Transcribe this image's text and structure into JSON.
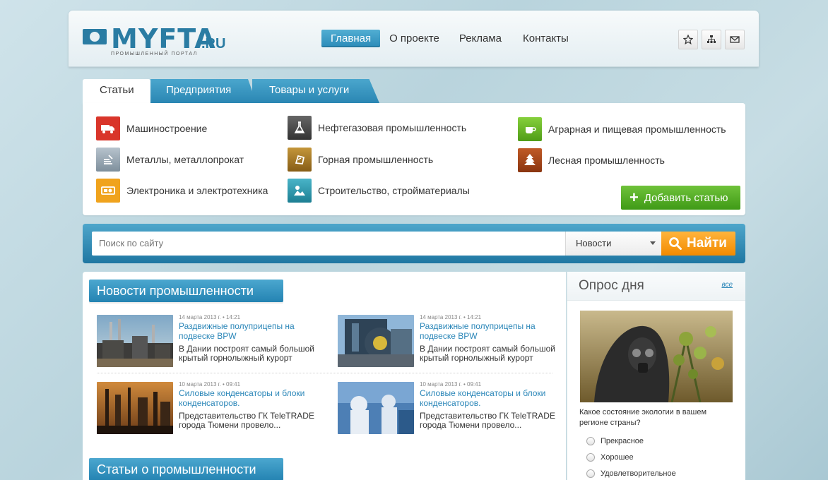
{
  "logo": {
    "name": "MYFTA",
    "tld": ".RU",
    "subtitle": "ПРОМЫШЛЕННЫЙ ПОРТАЛ"
  },
  "nav": {
    "items": [
      "Главная",
      "О проекте",
      "Реклама",
      "Контакты"
    ],
    "active": "Главная"
  },
  "header_icons": [
    "star-icon",
    "sitemap-icon",
    "mail-icon"
  ],
  "tabs": [
    "Статьи",
    "Предприятия",
    "Товары и услуги"
  ],
  "categories": [
    {
      "label": "Машиностроение",
      "icon": "truck-icon",
      "color": "#d9352a"
    },
    {
      "label": "Металлы, металлопрокат",
      "icon": "metal-icon",
      "color": "#8fa0ae"
    },
    {
      "label": "Электроника и электротехника",
      "icon": "electronics-icon",
      "color": "#f0a31d"
    },
    {
      "label": "Нефтегазовая промышленность",
      "icon": "flask-icon",
      "color": "#4a4a4a"
    },
    {
      "label": "Горная промышленность",
      "icon": "ore-icon",
      "color": "#a57a2a"
    },
    {
      "label": "Строительство, стройматериалы",
      "icon": "construction-icon",
      "color": "#2e9ab0"
    },
    {
      "label": "Аграрная и пищевая промышленность",
      "icon": "cup-icon",
      "color": "#6cbb2a"
    },
    {
      "label": "Лесная промышленность",
      "icon": "tree-icon",
      "color": "#a0481c"
    }
  ],
  "add_article": "Добавить статью",
  "search": {
    "placeholder": "Поиск по сайту",
    "select_value": "Новости",
    "button": "Найти"
  },
  "news_section": {
    "title": "Новости промышленности",
    "items": [
      {
        "date": "14 марта 2013 г. • 14:21",
        "title": "Раздвижные полуприцепы на подвеске BPW",
        "desc": "В Дании построят самый большой крытый горнолыжный курорт"
      },
      {
        "date": "14 марта 2013 г. • 14:21",
        "title": "Раздвижные полуприцепы на подвеске BPW",
        "desc": "В Дании построят самый большой крытый горнолыжный курорт"
      },
      {
        "date": "10 марта 2013 г. • 09:41",
        "title": "Силовые конденсаторы и блоки конденсаторов.",
        "desc": "Представительство ГК TeleTRADE города Тюмени провело..."
      },
      {
        "date": "10 марта 2013 г. • 09:41",
        "title": "Силовые конденсаторы и блоки конденсаторов.",
        "desc": "Представительство ГК TeleTRADE города Тюмени провело..."
      }
    ]
  },
  "articles_section": {
    "title": "Статьи о промышленности"
  },
  "poll": {
    "title": "Опрос дня",
    "all_link": "все",
    "question": "Какое состояние экологии в вашем регионе страны?",
    "options": [
      "Прекрасное",
      "Хорошее",
      "Удовлетворительное"
    ]
  }
}
